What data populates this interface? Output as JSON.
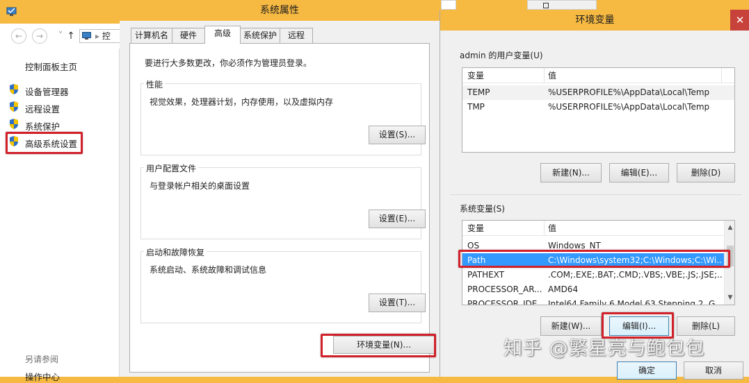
{
  "control_panel": {
    "address_text": "控",
    "home_link": "控制面板主页",
    "links": [
      "设备管理器",
      "远程设置",
      "系统保护",
      "高级系统设置"
    ],
    "see_also_title": "另请参阅",
    "see_also_item": "操作中心",
    "icons": {
      "back": "back-arrow-icon",
      "forward": "forward-arrow-icon",
      "up": "up-arrow-icon",
      "shield": "uac-shield-icon"
    }
  },
  "system_properties": {
    "title": "系统属性",
    "tabs": [
      "计算机名",
      "硬件",
      "高级",
      "系统保护",
      "远程"
    ],
    "active_tab": "高级",
    "admin_note": "要进行大多数更改，你必须作为管理员登录。",
    "performance": {
      "title": "性能",
      "description": "视觉效果，处理器计划，内存使用，以及虚拟内存",
      "button": "设置(S)..."
    },
    "user_profiles": {
      "title": "用户配置文件",
      "description": "与登录帐户相关的桌面设置",
      "button": "设置(E)..."
    },
    "startup_recovery": {
      "title": "启动和故障恢复",
      "description": "系统启动、系统故障和调试信息",
      "button": "设置(T)..."
    },
    "env_button": "环境变量(N)..."
  },
  "environment_variables": {
    "title": "环境变量",
    "close_glyph": "✕",
    "user_section": {
      "title": "admin 的用户变量(U)",
      "headers": [
        "变量",
        "值"
      ],
      "rows": [
        [
          "TEMP",
          "%USERPROFILE%\\AppData\\Local\\Temp"
        ],
        [
          "TMP",
          "%USERPROFILE%\\AppData\\Local\\Temp"
        ]
      ],
      "buttons": [
        "新建(N)...",
        "编辑(E)...",
        "删除(D)"
      ]
    },
    "system_section": {
      "title": "系统变量(S)",
      "headers": [
        "变量",
        "值"
      ],
      "rows": [
        [
          "OS",
          "Windows_NT"
        ],
        [
          "Path",
          "C:\\Windows\\system32;C:\\Windows;C:\\Wi..."
        ],
        [
          "PATHEXT",
          ".COM;.EXE;.BAT;.CMD;.VBS;.VBE;.JS;.JSE;..."
        ],
        [
          "PROCESSOR_AR...",
          "AMD64"
        ],
        [
          "PROCESSOR_IDE...",
          "Intel64 Family 6 Model 63 Stepping 2, G..."
        ]
      ],
      "selected_row": "Path",
      "buttons": [
        "新建(W)...",
        "编辑(I)...",
        "删除(L)"
      ]
    },
    "ok_button": "确定",
    "cancel_button": "取消"
  },
  "watermark": "知乎 @繁星亮与鲍包包",
  "colors": {
    "desktop": "#f6b942",
    "highlight_box": "#d1202a",
    "selection": "#3399ff",
    "close": "#c7423a"
  }
}
